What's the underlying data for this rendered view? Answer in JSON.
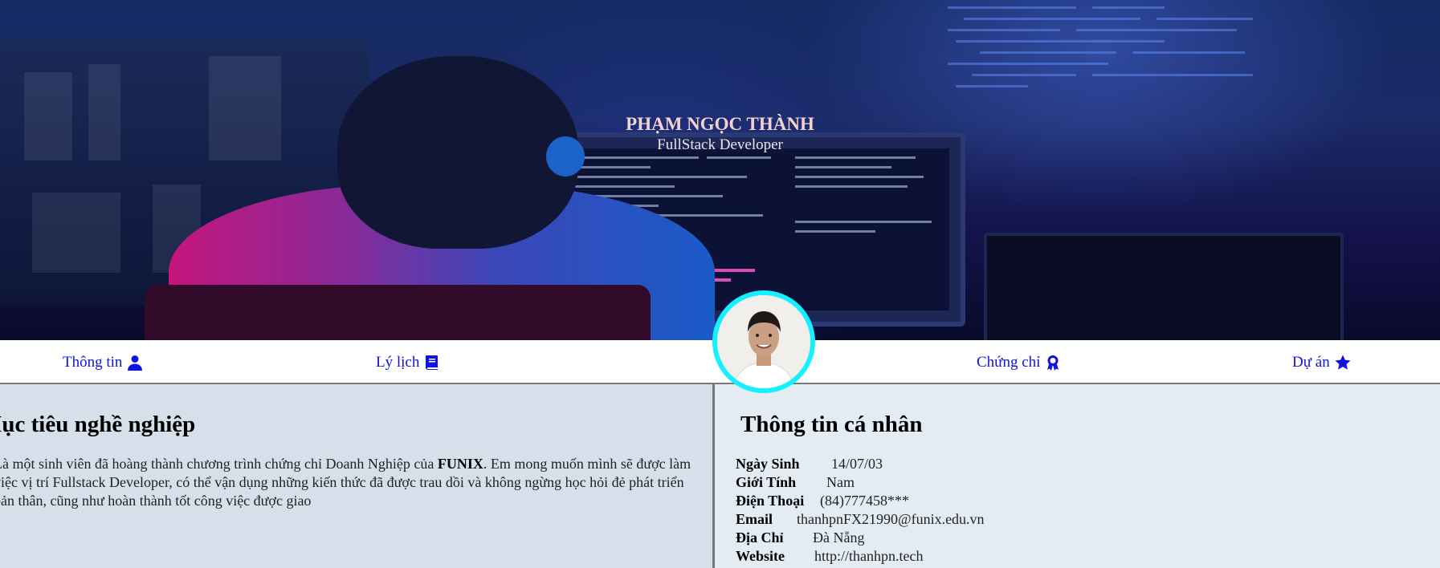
{
  "hero": {
    "name": "PHẠM NGỌC THÀNH",
    "role": "FullStack Developer"
  },
  "nav": {
    "items": [
      {
        "label": "Thông tin",
        "icon": "user-icon"
      },
      {
        "label": "Lý lịch",
        "icon": "book-icon"
      },
      {
        "label": "Chứng chỉ",
        "icon": "award-icon"
      },
      {
        "label": "Dự án",
        "icon": "star-icon"
      }
    ]
  },
  "objective": {
    "title": "Mục tiêu nghề nghiệp",
    "text_before": "Là một sinh viên đã hoàng thành chương trình chứng chỉ Doanh Nghiệp của ",
    "brand": "FUNIX",
    "text_after": ". Em mong muốn mình sẽ được làm việc vị trí Fullstack Developer, có thể vận dụng những kiến thức đã được trau dồi và không ngừng học hỏi đẻ phát triển bản thân, cũng như hoàn thành tốt công việc được giao"
  },
  "personal": {
    "title": "Thông tin cá nhân",
    "rows": [
      {
        "label": "Ngày Sinh",
        "value": "14/07/03"
      },
      {
        "label": "Giới Tính",
        "value": "Nam"
      },
      {
        "label": "Điện Thoại",
        "value": "(84)777458***"
      },
      {
        "label": "Email",
        "value": "thanhpnFX21990@funix.edu.vn"
      },
      {
        "label": "Địa Chỉ",
        "value": "Đà Nẵng"
      },
      {
        "label": "Website",
        "value": "http://thanhpn.tech"
      }
    ]
  },
  "colors": {
    "accent_link": "#1111e0",
    "avatar_border": "#14f0ff",
    "left_panel": "#d5e0ea",
    "right_panel": "#e4ecf3"
  }
}
